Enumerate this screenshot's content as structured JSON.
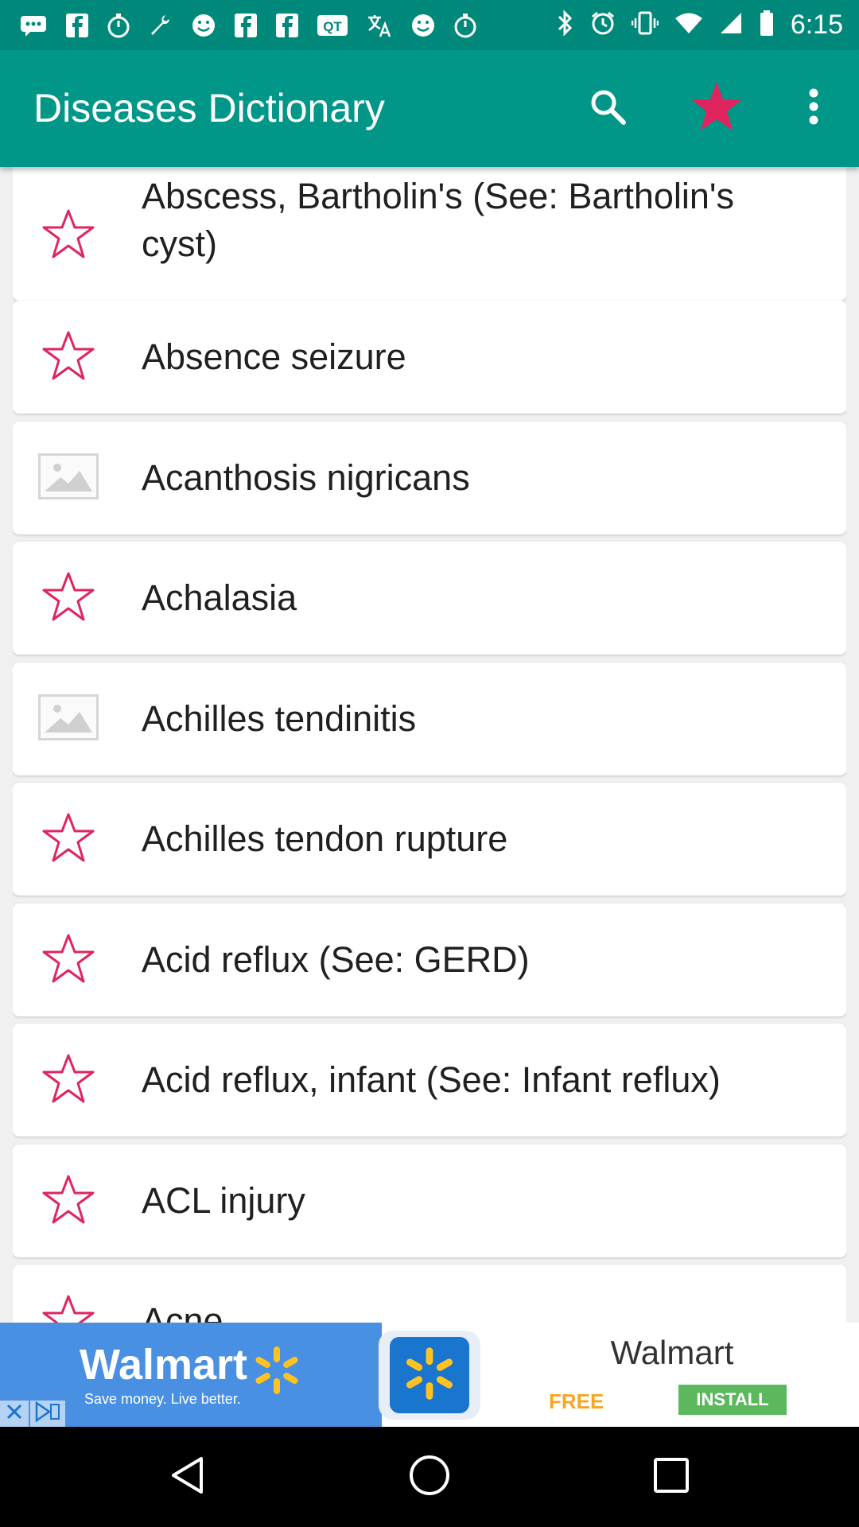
{
  "status_bar": {
    "time": "6:15",
    "left_icons": [
      "chat-icon",
      "facebook-icon",
      "stopwatch-icon",
      "wrench-icon",
      "smiley-icon",
      "facebook-icon",
      "facebook-icon",
      "qt-icon",
      "translate-icon",
      "smiley-icon",
      "stopwatch-icon"
    ],
    "right_icons": [
      "bluetooth-icon",
      "alarm-icon",
      "vibrate-icon",
      "wifi-icon",
      "signal-icon",
      "battery-icon"
    ]
  },
  "app_bar": {
    "title": "Diseases Dictionary",
    "actions": [
      "search-icon",
      "star-filled-icon",
      "more-vert-icon"
    ],
    "background_color": "#009688",
    "favorite_color": "#e0245e"
  },
  "list": {
    "items": [
      {
        "label": "Abscess, Bartholin's (See: Bartholin's cyst)",
        "icon": "star-outline-icon"
      },
      {
        "label": "Absence seizure",
        "icon": "star-outline-icon"
      },
      {
        "label": "Acanthosis nigricans",
        "icon": "image-placeholder-icon"
      },
      {
        "label": "Achalasia",
        "icon": "star-outline-icon"
      },
      {
        "label": "Achilles tendinitis",
        "icon": "image-placeholder-icon"
      },
      {
        "label": "Achilles tendon rupture",
        "icon": "star-outline-icon"
      },
      {
        "label": "Acid reflux (See: GERD)",
        "icon": "star-outline-icon"
      },
      {
        "label": "Acid reflux, infant (See: Infant reflux)",
        "icon": "star-outline-icon"
      },
      {
        "label": "ACL injury",
        "icon": "star-outline-icon"
      },
      {
        "label": "Acne",
        "icon": "star-outline-icon"
      }
    ],
    "star_color": "#e0245e"
  },
  "ad": {
    "logo_text": "Walmart",
    "tagline": "Save money. Live better.",
    "brand": "Walmart",
    "free_label": "FREE",
    "install_label": "INSTALL",
    "brand_blue": "#1a75cf",
    "spark_yellow": "#ffc220"
  },
  "nav_bar": {
    "buttons": [
      "back-icon",
      "home-icon",
      "recents-icon"
    ]
  }
}
